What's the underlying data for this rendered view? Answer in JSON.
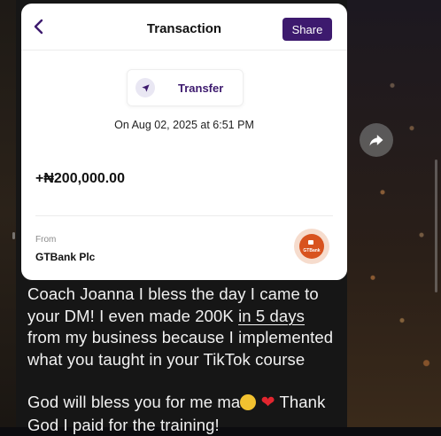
{
  "card": {
    "title": "Transaction",
    "share_label": "Share",
    "type_label": "Transfer",
    "date_line": "On Aug 02, 2025 at 6:51 PM",
    "amount": "+₦200,000.00",
    "from_label": "From",
    "bank_name": "GTBank Plc",
    "bank_logo_text": "GTBank"
  },
  "caption": {
    "line1": "Coach Joanna I bless the day I came to",
    "line2a": "your DM! I even made 200K ",
    "line2b": "in 5 days",
    "line3": "from my business because I implemented",
    "line4": "what you taught in your TikTok course",
    "line5a": "God will bless you for me ma",
    "line5b": " Thank",
    "line6": "God I paid for the training!"
  },
  "icons": {
    "back": "chevron-left-icon",
    "transfer": "send-arrow-icon",
    "share_fab": "share-arrow-icon",
    "emoji_cry": "crying-face-emoji",
    "emoji_heart": "red-heart-emoji"
  },
  "colors": {
    "accent": "#3d1a6e",
    "bank_orange": "#d8531f",
    "caption_bg": "#161616"
  }
}
